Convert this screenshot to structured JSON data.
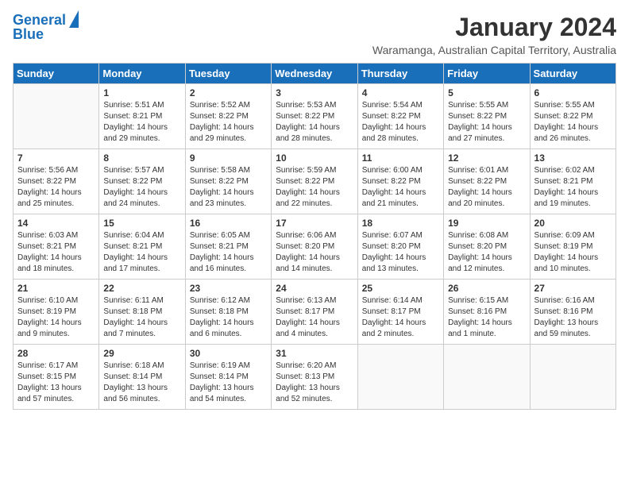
{
  "header": {
    "logo_line1": "General",
    "logo_line2": "Blue",
    "month": "January 2024",
    "location": "Waramanga, Australian Capital Territory, Australia"
  },
  "days_of_week": [
    "Sunday",
    "Monday",
    "Tuesday",
    "Wednesday",
    "Thursday",
    "Friday",
    "Saturday"
  ],
  "weeks": [
    [
      {
        "day": "",
        "info": ""
      },
      {
        "day": "1",
        "info": "Sunrise: 5:51 AM\nSunset: 8:21 PM\nDaylight: 14 hours\nand 29 minutes."
      },
      {
        "day": "2",
        "info": "Sunrise: 5:52 AM\nSunset: 8:22 PM\nDaylight: 14 hours\nand 29 minutes."
      },
      {
        "day": "3",
        "info": "Sunrise: 5:53 AM\nSunset: 8:22 PM\nDaylight: 14 hours\nand 28 minutes."
      },
      {
        "day": "4",
        "info": "Sunrise: 5:54 AM\nSunset: 8:22 PM\nDaylight: 14 hours\nand 28 minutes."
      },
      {
        "day": "5",
        "info": "Sunrise: 5:55 AM\nSunset: 8:22 PM\nDaylight: 14 hours\nand 27 minutes."
      },
      {
        "day": "6",
        "info": "Sunrise: 5:55 AM\nSunset: 8:22 PM\nDaylight: 14 hours\nand 26 minutes."
      }
    ],
    [
      {
        "day": "7",
        "info": "Sunrise: 5:56 AM\nSunset: 8:22 PM\nDaylight: 14 hours\nand 25 minutes."
      },
      {
        "day": "8",
        "info": "Sunrise: 5:57 AM\nSunset: 8:22 PM\nDaylight: 14 hours\nand 24 minutes."
      },
      {
        "day": "9",
        "info": "Sunrise: 5:58 AM\nSunset: 8:22 PM\nDaylight: 14 hours\nand 23 minutes."
      },
      {
        "day": "10",
        "info": "Sunrise: 5:59 AM\nSunset: 8:22 PM\nDaylight: 14 hours\nand 22 minutes."
      },
      {
        "day": "11",
        "info": "Sunrise: 6:00 AM\nSunset: 8:22 PM\nDaylight: 14 hours\nand 21 minutes."
      },
      {
        "day": "12",
        "info": "Sunrise: 6:01 AM\nSunset: 8:22 PM\nDaylight: 14 hours\nand 20 minutes."
      },
      {
        "day": "13",
        "info": "Sunrise: 6:02 AM\nSunset: 8:21 PM\nDaylight: 14 hours\nand 19 minutes."
      }
    ],
    [
      {
        "day": "14",
        "info": "Sunrise: 6:03 AM\nSunset: 8:21 PM\nDaylight: 14 hours\nand 18 minutes."
      },
      {
        "day": "15",
        "info": "Sunrise: 6:04 AM\nSunset: 8:21 PM\nDaylight: 14 hours\nand 17 minutes."
      },
      {
        "day": "16",
        "info": "Sunrise: 6:05 AM\nSunset: 8:21 PM\nDaylight: 14 hours\nand 16 minutes."
      },
      {
        "day": "17",
        "info": "Sunrise: 6:06 AM\nSunset: 8:20 PM\nDaylight: 14 hours\nand 14 minutes."
      },
      {
        "day": "18",
        "info": "Sunrise: 6:07 AM\nSunset: 8:20 PM\nDaylight: 14 hours\nand 13 minutes."
      },
      {
        "day": "19",
        "info": "Sunrise: 6:08 AM\nSunset: 8:20 PM\nDaylight: 14 hours\nand 12 minutes."
      },
      {
        "day": "20",
        "info": "Sunrise: 6:09 AM\nSunset: 8:19 PM\nDaylight: 14 hours\nand 10 minutes."
      }
    ],
    [
      {
        "day": "21",
        "info": "Sunrise: 6:10 AM\nSunset: 8:19 PM\nDaylight: 14 hours\nand 9 minutes."
      },
      {
        "day": "22",
        "info": "Sunrise: 6:11 AM\nSunset: 8:18 PM\nDaylight: 14 hours\nand 7 minutes."
      },
      {
        "day": "23",
        "info": "Sunrise: 6:12 AM\nSunset: 8:18 PM\nDaylight: 14 hours\nand 6 minutes."
      },
      {
        "day": "24",
        "info": "Sunrise: 6:13 AM\nSunset: 8:17 PM\nDaylight: 14 hours\nand 4 minutes."
      },
      {
        "day": "25",
        "info": "Sunrise: 6:14 AM\nSunset: 8:17 PM\nDaylight: 14 hours\nand 2 minutes."
      },
      {
        "day": "26",
        "info": "Sunrise: 6:15 AM\nSunset: 8:16 PM\nDaylight: 14 hours\nand 1 minute."
      },
      {
        "day": "27",
        "info": "Sunrise: 6:16 AM\nSunset: 8:16 PM\nDaylight: 13 hours\nand 59 minutes."
      }
    ],
    [
      {
        "day": "28",
        "info": "Sunrise: 6:17 AM\nSunset: 8:15 PM\nDaylight: 13 hours\nand 57 minutes."
      },
      {
        "day": "29",
        "info": "Sunrise: 6:18 AM\nSunset: 8:14 PM\nDaylight: 13 hours\nand 56 minutes."
      },
      {
        "day": "30",
        "info": "Sunrise: 6:19 AM\nSunset: 8:14 PM\nDaylight: 13 hours\nand 54 minutes."
      },
      {
        "day": "31",
        "info": "Sunrise: 6:20 AM\nSunset: 8:13 PM\nDaylight: 13 hours\nand 52 minutes."
      },
      {
        "day": "",
        "info": ""
      },
      {
        "day": "",
        "info": ""
      },
      {
        "day": "",
        "info": ""
      }
    ]
  ]
}
